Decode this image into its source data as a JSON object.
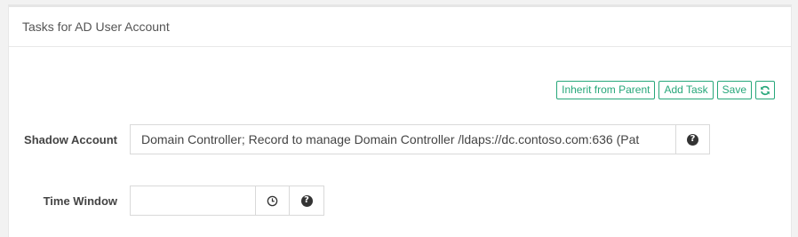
{
  "panel": {
    "title": "Tasks for AD User Account"
  },
  "toolbar": {
    "inherit_label": "Inherit from Parent",
    "add_task_label": "Add Task",
    "save_label": "Save",
    "refresh_icon": "refresh-icon",
    "accent_color": "#27a77a"
  },
  "form": {
    "shadow_account": {
      "label": "Shadow Account",
      "value": "Domain Controller; Record to manage Domain Controller /ldaps://dc.contoso.com:636 (Pat",
      "help_icon": "question-circle-icon"
    },
    "time_window": {
      "label": "Time Window",
      "value": "",
      "clock_icon": "clock-icon",
      "help_icon": "question-circle-icon"
    }
  }
}
